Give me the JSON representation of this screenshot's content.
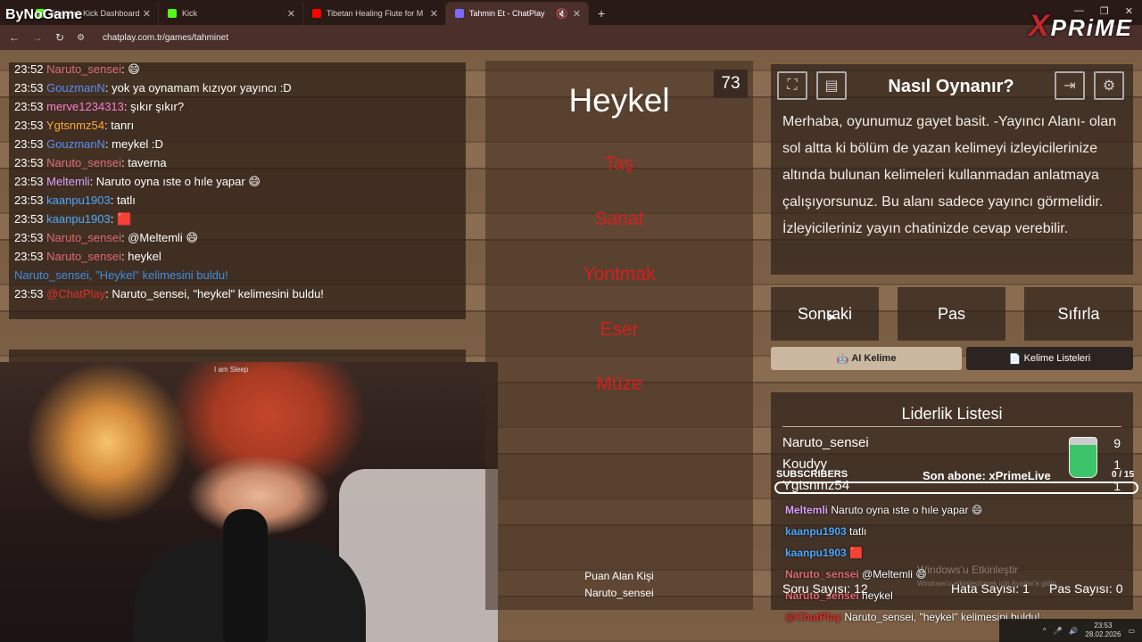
{
  "browser": {
    "brand": "ByNoGame",
    "tabs": [
      {
        "title": "Stream - Kick Dashboard",
        "color": "#53fc18"
      },
      {
        "title": "Kick",
        "color": "#53fc18"
      },
      {
        "title": "Tibetan Healing Flute for M",
        "color": "#ff0000"
      },
      {
        "title": "Tahmin Et - ChatPlay",
        "color": "#7b6cff"
      }
    ],
    "url": "chatplay.com.tr/games/tahminet",
    "overlay_logo": "PRiME",
    "overlay_logo_x": "X"
  },
  "chat": [
    {
      "time": "23:52",
      "user": "Naruto_sensei",
      "color": "#e06c75",
      "msg": ": 😄"
    },
    {
      "time": "23:53",
      "user": "GouzmanN",
      "color": "#5b8def",
      "msg": ": yok ya oynamam kızıyor yayıncı :D"
    },
    {
      "time": "23:53",
      "user": "merve1234313",
      "color": "#ff7bd5",
      "msg": ": şıkır şıkır?"
    },
    {
      "time": "23:53",
      "user": "Ygtsnmz54",
      "color": "#ffa63c",
      "msg": ": tanrı"
    },
    {
      "time": "23:53",
      "user": "GouzmanN",
      "color": "#5b8def",
      "msg": ": meykel :D"
    },
    {
      "time": "23:53",
      "user": "Naruto_sensei",
      "color": "#e06c75",
      "msg": ": taverna"
    },
    {
      "time": "23:53",
      "user": "Meltemli",
      "color": "#d9a0ff",
      "msg": ": Naruto oyna ıste o hıle yapar 😄"
    },
    {
      "time": "23:53",
      "user": "kaanpu1903",
      "color": "#4aa8ff",
      "msg": ": tatlı"
    },
    {
      "time": "23:53",
      "user": "kaanpu1903",
      "color": "#4aa8ff",
      "msg": ": 🟥"
    },
    {
      "time": "23:53",
      "user": "Naruto_sensei",
      "color": "#e06c75",
      "msg": ": @Meltemli 😄"
    },
    {
      "time": "23:53",
      "user": "Naruto_sensei",
      "color": "#e06c75",
      "msg": ": heykel"
    },
    {
      "time": "",
      "user": "Naruto_sensei, \"Heykel\" kelimesini buldu!",
      "color": "#3b8fe6",
      "msg": ""
    },
    {
      "time": "23:53",
      "user": "@ChatPlay",
      "color": "#e0302c",
      "msg": ": Naruto_sensei, \"heykel\" kelimesini buldu!"
    }
  ],
  "webcam_text": "I am Sleep",
  "game": {
    "timer": "73",
    "word": "Heykel",
    "taboo": [
      "Taş",
      "Sanat",
      "Yontmak",
      "Eser",
      "Müze"
    ],
    "scorer_label": "Puan Alan Kişi",
    "scorer_name": "Naruto_sensei"
  },
  "howto": {
    "title": "Nasıl Oynanır?",
    "text": "Merhaba, oyunumuz gayet basit. -Yayıncı Alanı- olan sol altta ki bölüm de yazan kelimeyi izleyicilerinize altında bulunan kelimeleri kullanmadan anlatmaya çalışıyorsunuz. Bu alanı sadece yayıncı görmelidir. İzleyicileriniz yayın chatinizde cevap verebilir."
  },
  "buttons": {
    "next": "Sonraki",
    "pass": "Pas",
    "reset": "Sıfırla",
    "ai": "AI Kelime",
    "lists": "Kelime Listeleri"
  },
  "leaderboard": {
    "title": "Liderlik Listesi",
    "rows": [
      {
        "name": "Naruto_sensei",
        "score": "9"
      },
      {
        "name": "Koudyy",
        "score": "1"
      },
      {
        "name": "Ygtsnmz54",
        "score": "1"
      }
    ]
  },
  "subs": {
    "label": "SUBSCRIBERS",
    "last": "Son abone: xPrimeLive",
    "count": "0 / 15"
  },
  "overlay_chat": [
    {
      "user": "Meltemli",
      "color": "#d9a0ff",
      "msg": "Naruto oyna ıste o hıle yapar 😄"
    },
    {
      "user": "kaanpu1903",
      "color": "#4aa8ff",
      "msg": "tatlı"
    },
    {
      "user": "kaanpu1903",
      "color": "#4aa8ff",
      "msg": "🟥"
    },
    {
      "user": "Naruto_sensei",
      "color": "#e06c75",
      "msg": "@Meltemli 😄"
    },
    {
      "user": "Naruto_sensei",
      "color": "#e06c75",
      "msg": "heykel"
    },
    {
      "user": "@ChatPlay",
      "color": "#e0302c",
      "msg": "Naruto_sensei, \"heykel\" kelimesini buldu!"
    }
  ],
  "stats": {
    "questions": "Soru Sayısı: 12",
    "errors": "Hata Sayısı: 1",
    "passes": "Pas Sayısı: 0"
  },
  "watermark": {
    "line1": "Windows'u Etkinleştir",
    "line2": "Windows'u etkinleştirmek için Ayarlar'a gidin."
  },
  "taskbar": {
    "time": "23:53",
    "date": "28.02.2026"
  }
}
